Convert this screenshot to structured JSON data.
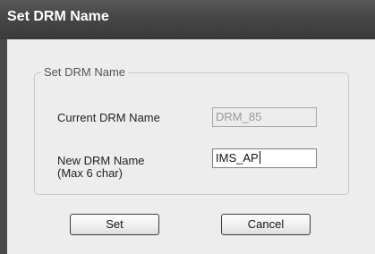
{
  "window": {
    "title": "Set DRM Name"
  },
  "group": {
    "legend": "Set DRM Name",
    "current_label": "Current DRM Name",
    "current_value": "DRM_85",
    "new_label_line1": "New DRM Name",
    "new_label_line2": "(Max 6 char)",
    "new_value": "IMS_AP"
  },
  "buttons": {
    "set_label": "Set",
    "cancel_label": "Cancel"
  }
}
